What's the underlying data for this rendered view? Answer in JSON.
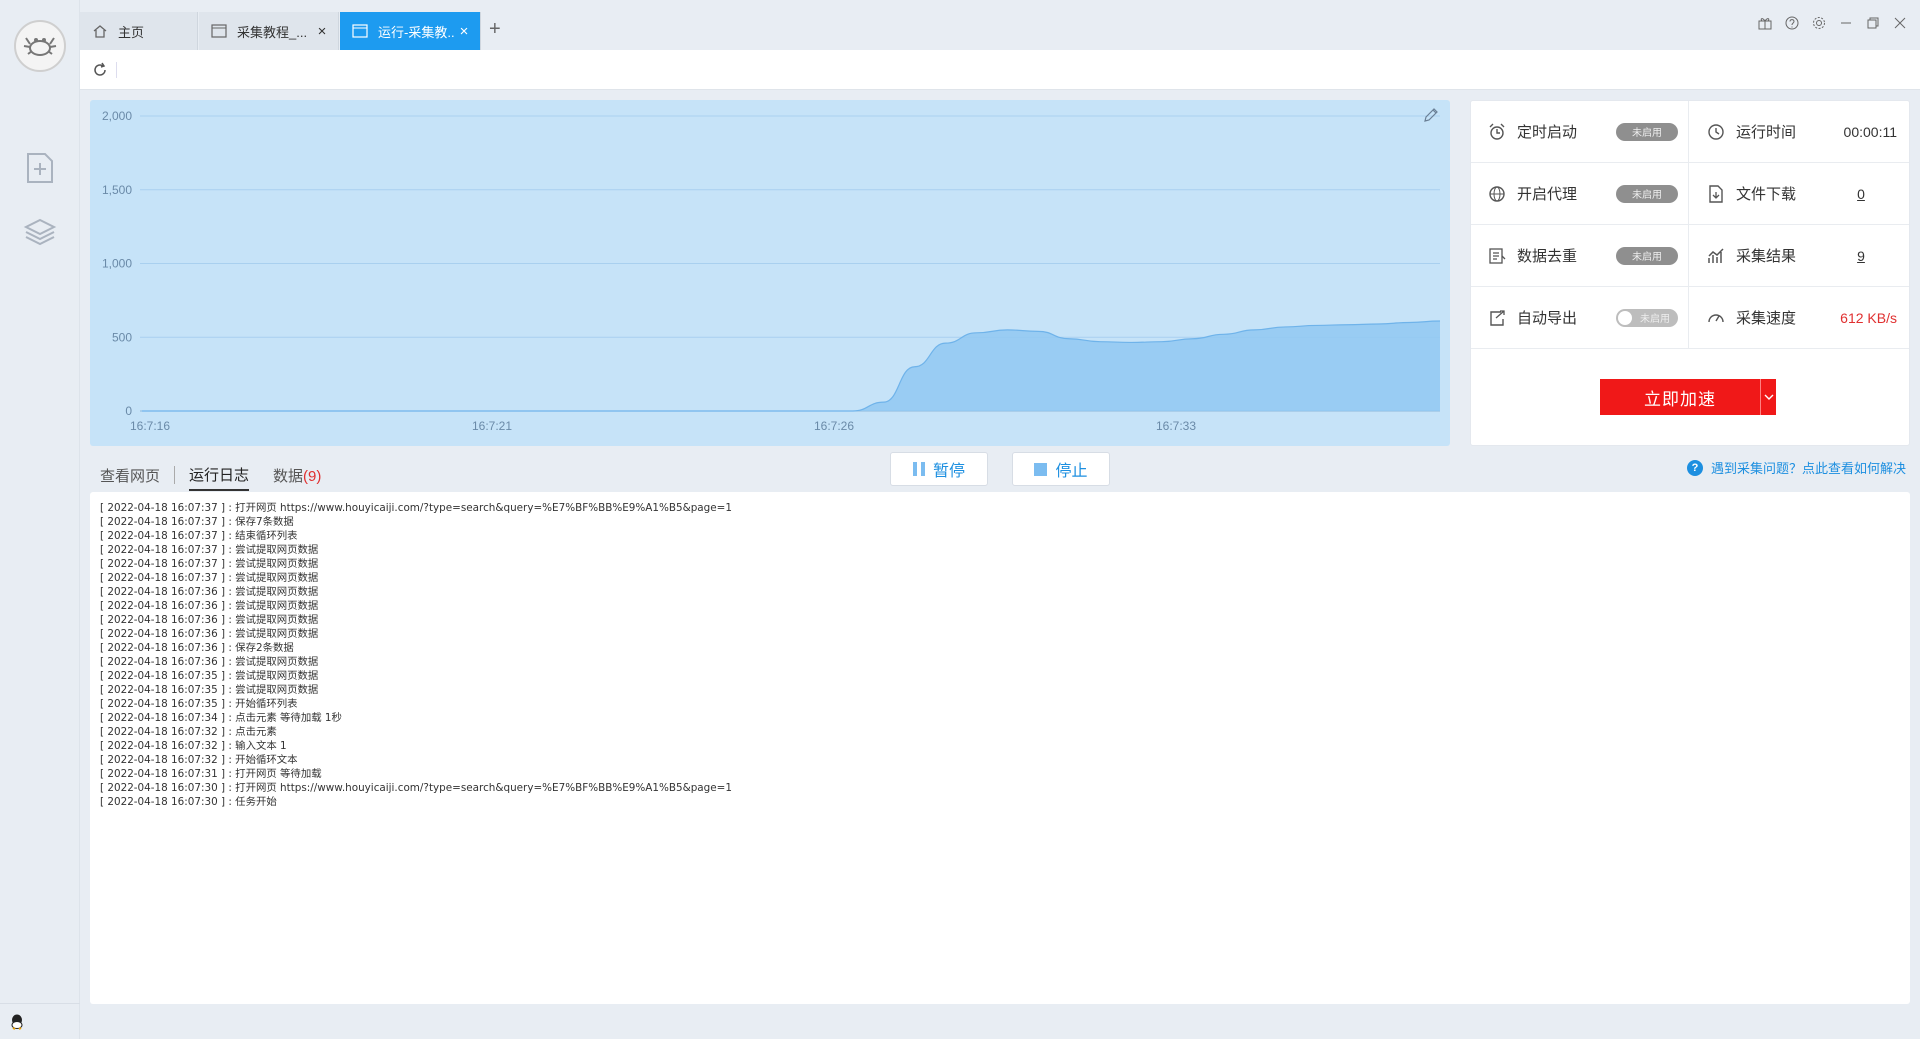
{
  "tabs": [
    {
      "label": "主页",
      "closable": false,
      "active": false
    },
    {
      "label": "采集教程_...",
      "closable": true,
      "active": false
    },
    {
      "label": "运行-采集教...",
      "closable": true,
      "active": true
    }
  ],
  "window_controls": [
    "gift-icon",
    "help-icon",
    "settings-icon",
    "minimize-icon",
    "restore-icon",
    "close-icon"
  ],
  "chart_data": {
    "type": "area",
    "x_ticks": [
      "16:7:16",
      "16:7:21",
      "16:7:26",
      "16:7:33"
    ],
    "y_ticks": [
      "2,000",
      "1,500",
      "1,000",
      "500",
      "0"
    ],
    "ylim": [
      0,
      2000
    ],
    "series": [
      {
        "values": [
          0,
          0,
          0,
          0,
          0,
          0,
          0,
          0,
          0,
          0,
          0,
          0,
          0,
          0,
          0,
          0,
          0,
          0,
          0,
          0,
          0,
          0,
          0,
          0,
          60,
          300,
          460,
          530,
          550,
          540,
          490,
          470,
          465,
          470,
          490,
          520,
          550,
          570,
          580,
          585,
          590,
          600,
          610
        ]
      }
    ],
    "color": "#90c8f2",
    "grid": true
  },
  "stats": {
    "scheduled_start": {
      "label": "定时启动",
      "state": "未启用"
    },
    "run_time": {
      "label": "运行时间",
      "value": "00:00:11"
    },
    "proxy": {
      "label": "开启代理",
      "state": "未启用"
    },
    "file_download": {
      "label": "文件下载",
      "value": "0"
    },
    "dedupe": {
      "label": "数据去重",
      "state": "未启用"
    },
    "results": {
      "label": "采集结果",
      "value": "9"
    },
    "auto_export": {
      "label": "自动导出",
      "state": "未启用"
    },
    "speed": {
      "label": "采集速度",
      "value": "612 KB/s"
    },
    "accelerate_label": "立即加速"
  },
  "subtabs": {
    "view_page": "查看网页",
    "run_log": "运行日志",
    "data": "数据",
    "data_count_text": "(9)"
  },
  "actions": {
    "pause": "暂停",
    "stop": "停止"
  },
  "help_text": "遇到采集问题？点此查看如何解决",
  "log_lines": [
    "[ 2022-04-18 16:07:37 ] : 打开网页 https://www.houyicaiji.com/?type=search&query=%E7%BF%BB%E9%A1%B5&page=1",
    "[ 2022-04-18 16:07:37 ] : 保存7条数据",
    "[ 2022-04-18 16:07:37 ] : 结束循环列表",
    "[ 2022-04-18 16:07:37 ] : 尝试提取网页数据",
    "[ 2022-04-18 16:07:37 ] : 尝试提取网页数据",
    "[ 2022-04-18 16:07:37 ] : 尝试提取网页数据",
    "[ 2022-04-18 16:07:36 ] : 尝试提取网页数据",
    "[ 2022-04-18 16:07:36 ] : 尝试提取网页数据",
    "[ 2022-04-18 16:07:36 ] : 尝试提取网页数据",
    "[ 2022-04-18 16:07:36 ] : 尝试提取网页数据",
    "[ 2022-04-18 16:07:36 ] : 保存2条数据",
    "[ 2022-04-18 16:07:36 ] : 尝试提取网页数据",
    "[ 2022-04-18 16:07:35 ] : 尝试提取网页数据",
    "[ 2022-04-18 16:07:35 ] : 尝试提取网页数据",
    "[ 2022-04-18 16:07:35 ] : 开始循环列表",
    "[ 2022-04-18 16:07:34 ] : 点击元素 等待加载 1秒",
    "[ 2022-04-18 16:07:32 ] : 点击元素",
    "[ 2022-04-18 16:07:32 ] : 输入文本 1",
    "[ 2022-04-18 16:07:32 ] : 开始循环文本",
    "[ 2022-04-18 16:07:31 ] : 打开网页 等待加载",
    "[ 2022-04-18 16:07:30 ] : 打开网页 https://www.houyicaiji.com/?type=search&query=%E7%BF%BB%E9%A1%B5&page=1",
    "[ 2022-04-18 16:07:30 ] : 任务开始"
  ]
}
